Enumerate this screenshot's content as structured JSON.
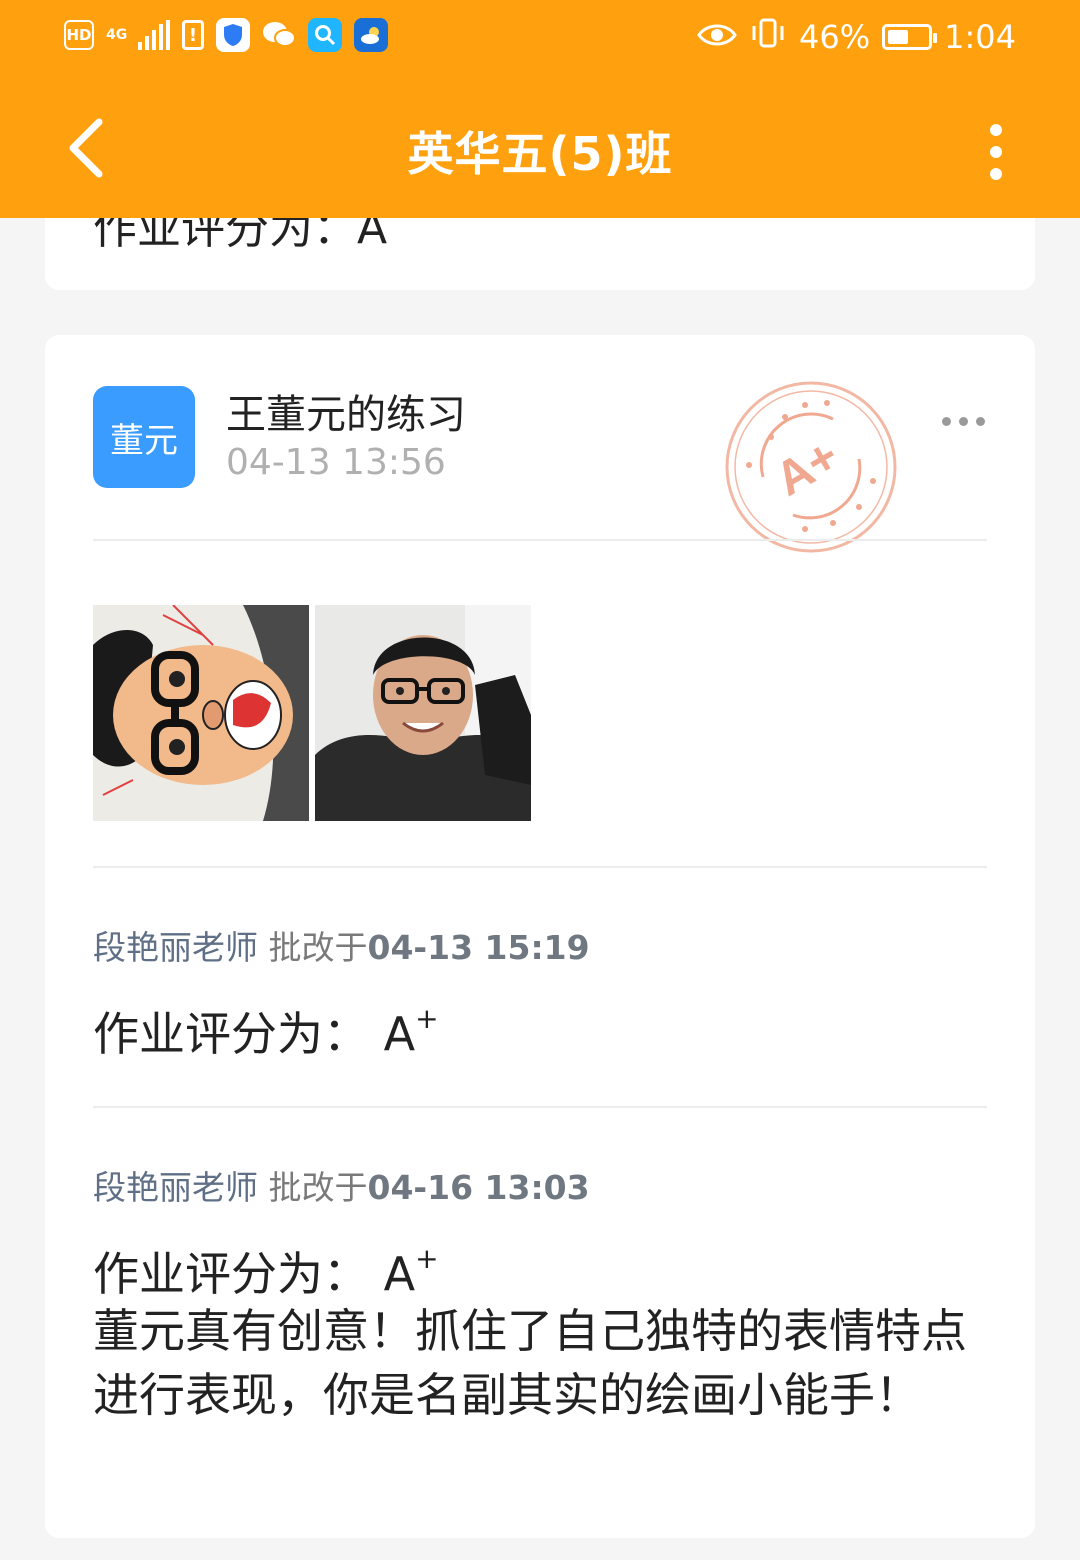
{
  "status_bar": {
    "hd": "HD",
    "network": "4G",
    "battery_percent": "46%",
    "time": "1:04",
    "battery_level": 0.46
  },
  "app_bar": {
    "title": "英华五(5)班"
  },
  "previous_card": {
    "grade_text": "作业评分为：A"
  },
  "post": {
    "avatar_text": "董元",
    "title": "王董元的练习",
    "time": "04-13 13:56",
    "stamp_text": "A+",
    "photos": [
      "drawing-caricature",
      "student-selfie"
    ]
  },
  "reviews": [
    {
      "teacher": "段艳丽老师",
      "action": "批改于",
      "time": "04-13 15:19",
      "grade_label": "作业评分为：",
      "grade": "A",
      "grade_sup": "+"
    },
    {
      "teacher": "段艳丽老师",
      "action": "批改于",
      "time": "04-16 13:03",
      "grade_label": "作业评分为：",
      "grade": "A",
      "grade_sup": "+",
      "comment": "董元真有创意！抓住了自己独特的表情特点进行表现，你是名副其实的绘画小能手！"
    }
  ],
  "colors": {
    "brand": "#ffa00f",
    "avatar": "#3b9cff",
    "stamp": "#f0a890",
    "meta": "#5f6f86"
  }
}
